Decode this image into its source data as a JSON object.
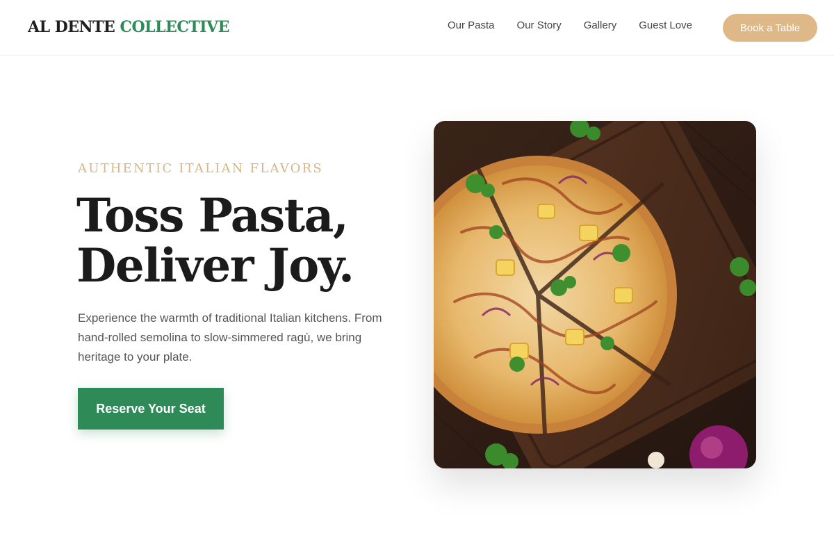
{
  "brand": {
    "name_part1": "AL DENTE",
    "name_part2": "COLLECTIVE",
    "accent_color": "#2e8b57"
  },
  "nav": {
    "items": [
      {
        "label": "Our Pasta"
      },
      {
        "label": "Our Story"
      },
      {
        "label": "Gallery"
      },
      {
        "label": "Guest Love"
      }
    ],
    "cta_label": "Book a Table",
    "cta_color": "#dfb887"
  },
  "hero": {
    "kicker": "AUTHENTIC ITALIAN FLAVORS",
    "headline_line1": "Toss Pasta,",
    "headline_line2": "Deliver Joy.",
    "description": "Experience the warmth of traditional Italian kitchens. From hand-rolled semolina to slow-simmered ragù, we bring heritage to your plate.",
    "cta_label": "Reserve Your Seat",
    "image_subject": "pizza-on-wooden-board"
  }
}
